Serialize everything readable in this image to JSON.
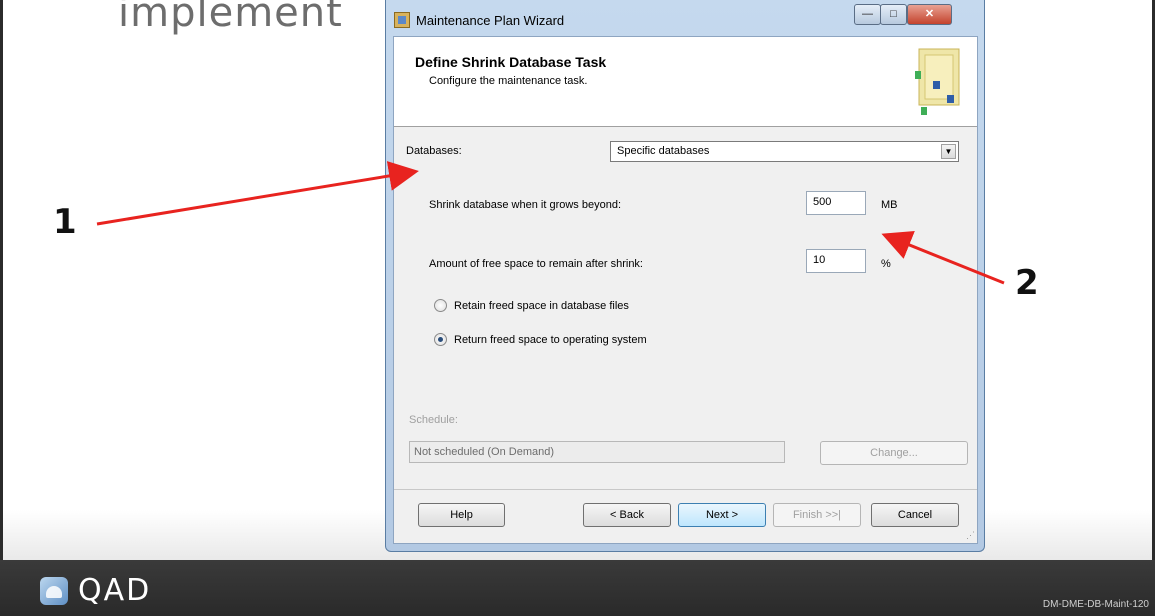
{
  "slide": {
    "title": "implement",
    "callout_1": "1",
    "callout_2": "2",
    "footer_brand": "QAD",
    "footer_code": "DM-DME-DB-Maint-120"
  },
  "window": {
    "title": "Maintenance Plan Wizard",
    "buttons": {
      "minimize": "—",
      "maximize": "□",
      "close": "✕"
    }
  },
  "header": {
    "title": "Define Shrink Database Task",
    "subtitle": "Configure the maintenance task."
  },
  "form": {
    "databases_label": "Databases:",
    "databases_value": "Specific databases",
    "shrink_label": "Shrink database when it grows beyond:",
    "shrink_value": "500",
    "shrink_unit": "MB",
    "free_space_label": "Amount of free space to remain after shrink:",
    "free_space_value": "10",
    "free_space_unit": "%",
    "radio_retain": "Retain freed space in database files",
    "radio_return": "Return freed space to operating system",
    "selected_option": "return"
  },
  "schedule": {
    "label": "Schedule:",
    "value": "Not scheduled (On Demand)",
    "change_button": "Change..."
  },
  "footer_buttons": {
    "help": "Help",
    "back": "< Back",
    "next": "Next >",
    "finish": "Finish >>|",
    "cancel": "Cancel"
  },
  "colors": {
    "arrow": "#e8231f",
    "footer_bg": "#2f2f2f"
  }
}
